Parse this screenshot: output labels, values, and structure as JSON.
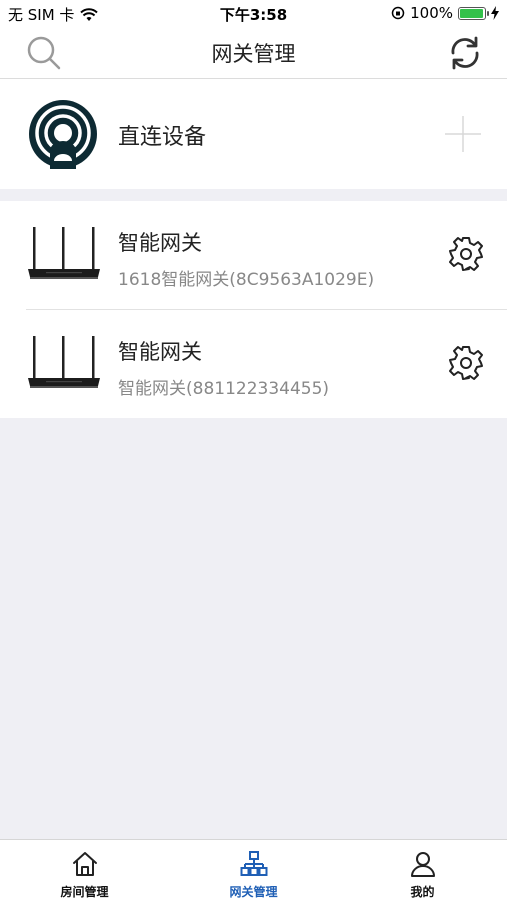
{
  "status_bar": {
    "carrier": "无 SIM 卡",
    "time": "下午3:58",
    "battery_percent": "100%"
  },
  "nav": {
    "title": "网关管理",
    "search_icon": "search-icon",
    "refresh_icon": "refresh-icon"
  },
  "direct": {
    "label": "直连设备",
    "icon": "wireless-broadcast-icon",
    "add_icon": "plus-icon"
  },
  "gateways": [
    {
      "title": "智能网关",
      "subtitle": "1618智能网关(8C9563A1029E)"
    },
    {
      "title": "智能网关",
      "subtitle": "智能网关(881122334455)"
    }
  ],
  "tabs": [
    {
      "label": "房间管理",
      "icon": "home-icon",
      "active": false
    },
    {
      "label": "网关管理",
      "icon": "network-icon",
      "active": true
    },
    {
      "label": "我的",
      "icon": "user-icon",
      "active": false
    }
  ],
  "colors": {
    "accent": "#1f5fb5",
    "background": "#efeff4",
    "battery": "#33c14a"
  }
}
